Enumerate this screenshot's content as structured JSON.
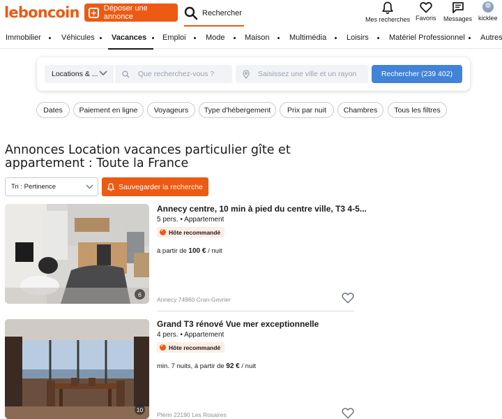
{
  "header": {
    "logo": "leboncoin",
    "post_button": "Déposer une annonce",
    "search_link": "Rechercher",
    "my_searches": "Mes recherches",
    "favorites": "Favoris",
    "messages": "Messages",
    "username": "kicklee"
  },
  "categories": [
    {
      "label": "Immobilier"
    },
    {
      "label": "Véhicules"
    },
    {
      "label": "Vacances"
    },
    {
      "label": "Emploi"
    },
    {
      "label": "Mode"
    },
    {
      "label": "Maison"
    },
    {
      "label": "Multimédia"
    },
    {
      "label": "Loisirs"
    },
    {
      "label": "Matériel Professionnel"
    },
    {
      "label": "Autres"
    }
  ],
  "active_category": "Vacances",
  "search": {
    "category": "Locations & ...",
    "query_placeholder": "Que recherchez-vous ?",
    "location_placeholder": "Saisissez une ville et un rayon",
    "button": "Rechercher (239 402)"
  },
  "filters": [
    "Dates",
    "Paiement en ligne",
    "Voyageurs",
    "Type d'hébergement",
    "Prix par nuit",
    "Chambres",
    "Tous les filtres"
  ],
  "page": {
    "title": "Annonces Location vacances particulier gîte et appartement : Toute la France",
    "sort": "Tri : Pertinence",
    "save_search": "Sauvegarder la recherche"
  },
  "listings": [
    {
      "title": "Annecy centre, 10 min à pied du centre ville, T3 4-5...",
      "sub": "5 pers. • Appartement",
      "badge": "Hôte recommandé",
      "price_prefix": "à partir de",
      "price": "100 €",
      "price_suffix": "/ nuit",
      "location": "Annecy 74960 Cran-Gevrier",
      "photo_count": "6"
    },
    {
      "title": "Grand T3 rénové Vue mer exceptionnelle",
      "sub": "4 pers. • Appartement",
      "badge": "Hôte recommandé",
      "price_prefix": "min. 7 nuits, à partir de",
      "price": "92 €",
      "price_suffix": "/ nuit",
      "location": "Plérin 22190 Les Rosaires",
      "photo_count": "10"
    }
  ],
  "colors": {
    "brand_orange": "#ec5a13",
    "search_blue": "#4183d7"
  }
}
